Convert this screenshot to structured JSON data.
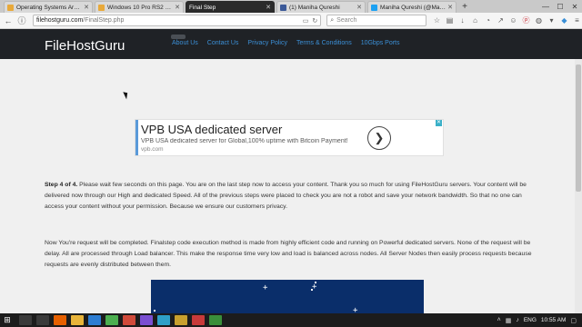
{
  "browser": {
    "tabs": [
      {
        "label": "Operating Systems Archives",
        "favicon_color": "#e8a93a",
        "active": false
      },
      {
        "label": "Windows 10 Pro RS2 v1703.1",
        "favicon_color": "#e8a93a",
        "active": false
      },
      {
        "label": "Final Step",
        "favicon_color": "#ffffff",
        "active": true
      },
      {
        "label": "(1) Maniha Qureshi",
        "favicon_color": "#3b5998",
        "active": false
      },
      {
        "label": "Maniha Qureshi (@Maniha",
        "favicon_color": "#1da1f2",
        "active": false
      }
    ],
    "url_domain": "filehostguru.com",
    "url_path": "/FinalStep.php",
    "search_placeholder": "Search"
  },
  "site": {
    "logo": "FileHostGuru",
    "nav": [
      "About Us",
      "Contact Us",
      "Privacy Policy",
      "Terms & Conditions",
      "10Gbps Ports"
    ]
  },
  "ad": {
    "headline": "VPB USA dedicated server",
    "description": "VPB USA dedicated server for Global,100% uptime with Bitcoin Payment!",
    "domain": "vpb.com"
  },
  "content": {
    "step_label": "Step 4 of 4.",
    "paragraph1": " Please wait few seconds on this page. You are on the last step now to access your content. Thank you so much for using FileHostGuru servers. Your content will be delivered now through our High and dedicated Speed. All of the previous steps were placed to check you are not a robot and save your network bandwidth. So that no one can access your content without your permission. Because we ensure our customers privacy.",
    "paragraph2": "Now You're request will be completed. Finalstep code execution method is made from highly efficient code and running on Powerful dedicated servers. None of the request will be delay. All are processed through Load balancer. This make the response time very low and load is balanced across nodes. All Server Nodes then easily process requests because requests are evenly distributed between them."
  },
  "taskbar": {
    "language": "ENG",
    "time": "10:55 AM"
  }
}
